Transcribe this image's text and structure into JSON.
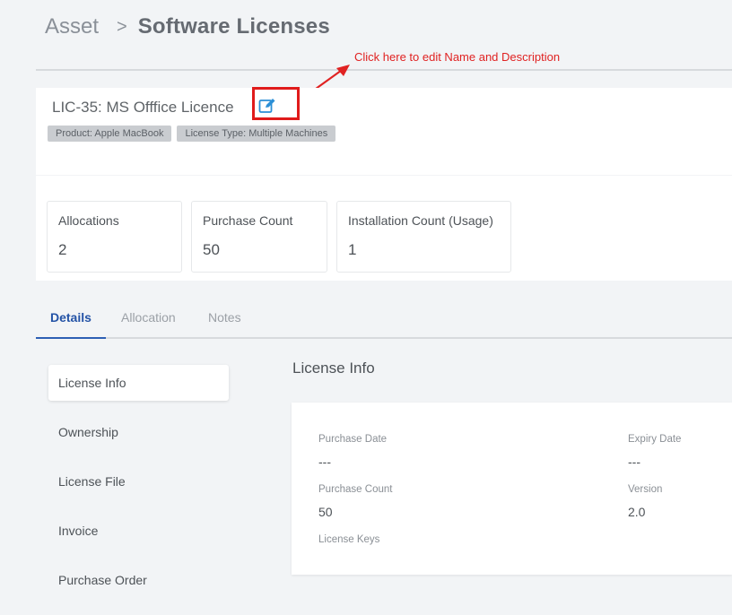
{
  "breadcrumb": {
    "root": "Asset",
    "separator": ">",
    "current": "Software Licenses"
  },
  "annotation": {
    "text": "Click here to edit Name and Description",
    "color": "#e02222"
  },
  "license": {
    "title": "LIC-35: MS Offfice Licence",
    "edit_icon": "edit-icon",
    "tags": [
      "Product: Apple MacBook",
      "License Type: Multiple Machines"
    ]
  },
  "stats": [
    {
      "label": "Allocations",
      "value": "2"
    },
    {
      "label": "Purchase Count",
      "value": "50"
    },
    {
      "label": "Installation Count (Usage)",
      "value": "1"
    }
  ],
  "tabs": [
    {
      "label": "Details",
      "active": true
    },
    {
      "label": "Allocation",
      "active": false
    },
    {
      "label": "Notes",
      "active": false
    }
  ],
  "sidebar": {
    "items": [
      {
        "label": "License Info",
        "selected": true
      },
      {
        "label": "Ownership",
        "selected": false
      },
      {
        "label": "License File",
        "selected": false
      },
      {
        "label": "Invoice",
        "selected": false
      },
      {
        "label": "Purchase Order",
        "selected": false
      }
    ]
  },
  "license_info": {
    "title": "License Info",
    "fields": {
      "purchase_date": {
        "label": "Purchase Date",
        "value": "---"
      },
      "expiry_date": {
        "label": "Expiry Date",
        "value": "---"
      },
      "purchase_count": {
        "label": "Purchase Count",
        "value": "50"
      },
      "version": {
        "label": "Version",
        "value": "2.0"
      },
      "license_keys": {
        "label": "License Keys",
        "value": ""
      }
    }
  },
  "colors": {
    "accent": "#2453a6",
    "annotation_red": "#e01b1b",
    "tag_bg": "#c9ccd0"
  }
}
